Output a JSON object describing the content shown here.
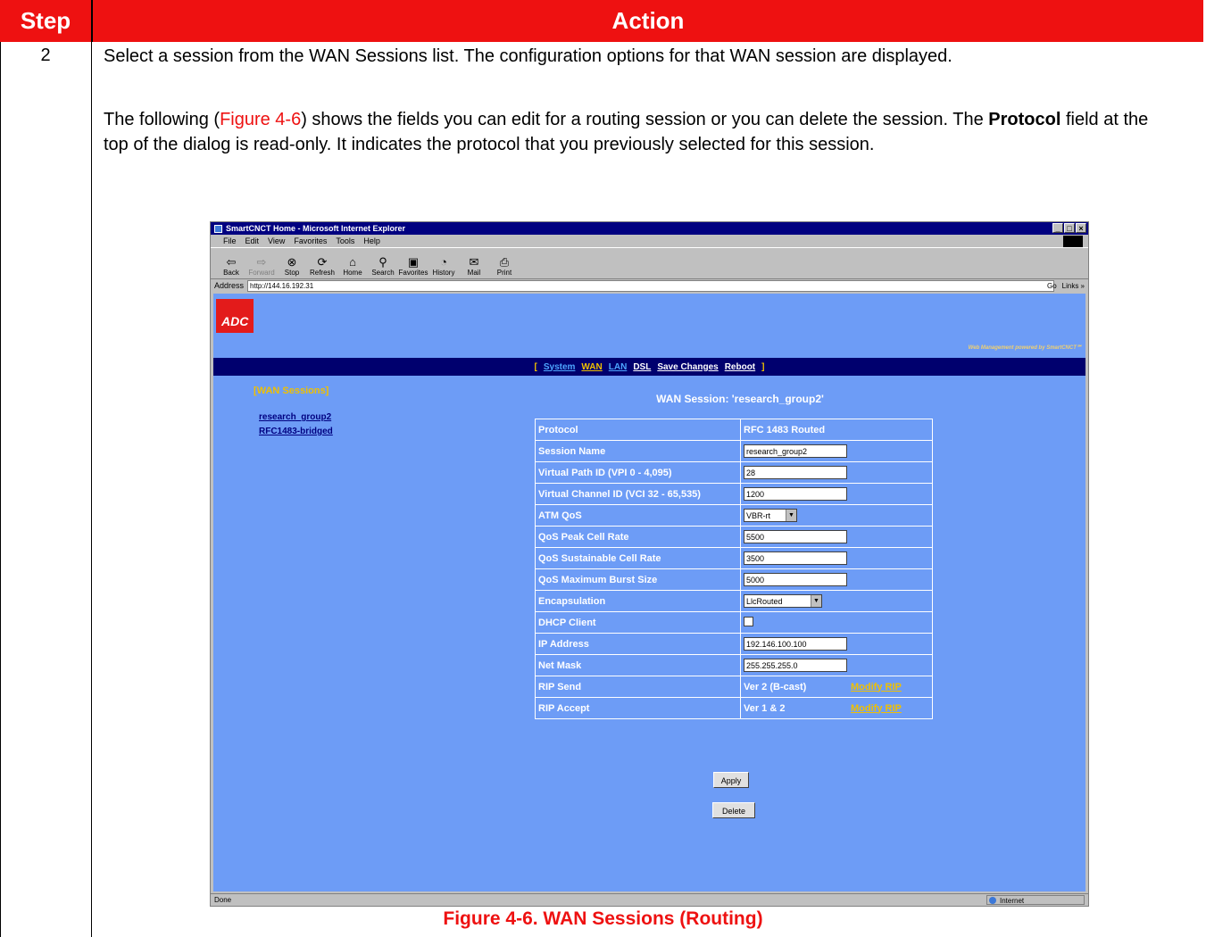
{
  "table": {
    "header_step": "Step",
    "header_action": "Action",
    "step_number": "2"
  },
  "text": {
    "p1": "Select a session from the WAN Sessions list. The configuration options for that WAN session are displayed.",
    "p2_before": "The following (",
    "p2_figref": "Figure 4-6",
    "p2_mid1": ") shows the fields you can edit for a routing session or you can delete the session. The ",
    "p2_bold": "Protocol",
    "p2_after": " field at the top of the dialog is read-only. It indicates the protocol that you previously selected for this session."
  },
  "caption": "Figure 4-6. WAN Sessions (Routing)",
  "browser": {
    "title": "SmartCNCT Home - Microsoft Internet Explorer",
    "menu": [
      "File",
      "Edit",
      "View",
      "Favorites",
      "Tools",
      "Help"
    ],
    "toolbar": [
      "Back",
      "Forward",
      "Stop",
      "Refresh",
      "Home",
      "Search",
      "Favorites",
      "History",
      "Mail",
      "Print"
    ],
    "address_label": "Address",
    "address_value": "http://144.16.192.31",
    "go_label": "Go",
    "links_label": "Links »",
    "status_text": "Done",
    "zone_text": "Internet"
  },
  "app": {
    "logo": "ADC",
    "powered_by": "Web Management powered by SmartCNCT℠",
    "nav": {
      "open": "[",
      "system": "System",
      "wan": "WAN",
      "lan": "LAN",
      "dsl": "DSL",
      "save": "Save Changes",
      "reboot": "Reboot",
      "close": "]"
    },
    "sidebar_title": "[WAN Sessions]",
    "sessions": [
      "research_group2",
      "RFC1483-bridged"
    ],
    "session_title": "WAN Session: 'research_group2'",
    "fields": {
      "protocol": {
        "label": "Protocol",
        "value": "RFC 1483 Routed"
      },
      "session_name": {
        "label": "Session Name",
        "value": "research_group2"
      },
      "vpi": {
        "label": "Virtual Path ID (VPI 0 - 4,095)",
        "value": "28"
      },
      "vci": {
        "label": "Virtual Channel ID (VCI 32 - 65,535)",
        "value": "1200"
      },
      "atm_qos": {
        "label": "ATM QoS",
        "value": "VBR-rt"
      },
      "peak": {
        "label": "QoS Peak Cell Rate",
        "value": "5500"
      },
      "sustainable": {
        "label": "QoS Sustainable Cell Rate",
        "value": "3500"
      },
      "burst": {
        "label": "QoS Maximum Burst Size",
        "value": "5000"
      },
      "encap": {
        "label": "Encapsulation",
        "value": "LlcRouted"
      },
      "dhcp": {
        "label": "DHCP Client",
        "checked": false
      },
      "ip": {
        "label": "IP Address",
        "value": "192.146.100.100"
      },
      "mask": {
        "label": "Net Mask",
        "value": "255.255.255.0"
      },
      "rip_send": {
        "label": "RIP Send",
        "value": "Ver 2 (B-cast)",
        "link": "Modify RIP"
      },
      "rip_accept": {
        "label": "RIP Accept",
        "value": "Ver 1  & 2",
        "link": "Modify RIP"
      }
    },
    "apply_label": "Apply",
    "delete_label": "Delete"
  }
}
